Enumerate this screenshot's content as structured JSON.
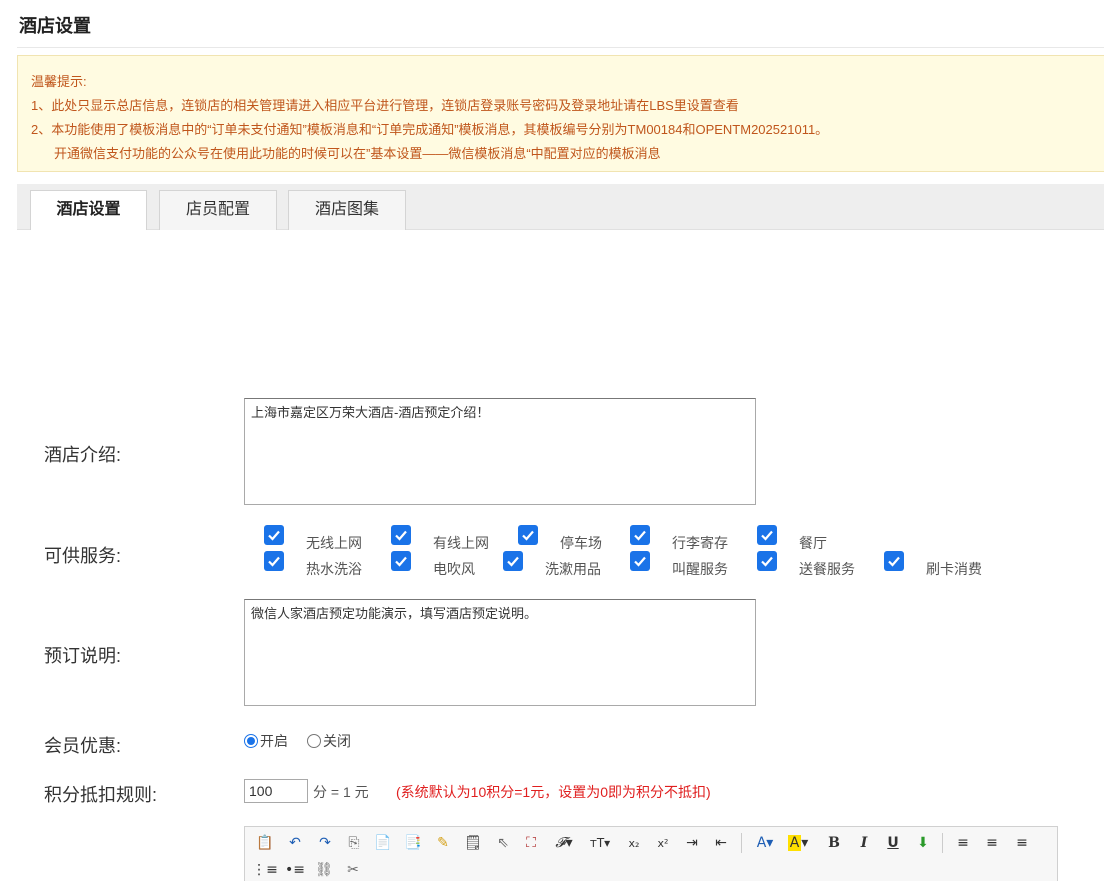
{
  "page": {
    "title": "酒店设置"
  },
  "notice": {
    "heading": "温馨提示:",
    "line1": "1、此处只显示总店信息，连锁店的相关管理请进入相应平台进行管理，连锁店登录账号密码及登录地址请在LBS里设置查看",
    "line2": "2、本功能使用了模板消息中的“订单未支付通知”模板消息和“订单完成通知”模板消息，其模板编号分别为TM00184和OPENTM202521011。",
    "line3": "开通微信支付功能的公众号在使用此功能的时候可以在”基本设置——微信模板消息“中配置对应的模板消息"
  },
  "tabs": [
    {
      "label": "酒店设置",
      "active": true
    },
    {
      "label": "店员配置",
      "active": false
    },
    {
      "label": "酒店图集",
      "active": false
    }
  ],
  "form": {
    "intro": {
      "label": "酒店介绍:",
      "value": "上海市嘉定区万荣大酒店-酒店预定介绍！"
    },
    "services": {
      "label": "可供服务:",
      "items": [
        {
          "label": "无线上网",
          "checked": true
        },
        {
          "label": "有线上网",
          "checked": true
        },
        {
          "label": "停车场",
          "checked": true
        },
        {
          "label": "行李寄存",
          "checked": true
        },
        {
          "label": "餐厅",
          "checked": true
        },
        {
          "label": "热水洗浴",
          "checked": true
        },
        {
          "label": "电吹风",
          "checked": true
        },
        {
          "label": "洗漱用品",
          "checked": true
        },
        {
          "label": "叫醒服务",
          "checked": true
        },
        {
          "label": "送餐服务",
          "checked": true
        },
        {
          "label": "刷卡消费",
          "checked": true
        }
      ]
    },
    "booking": {
      "label": "预订说明:",
      "value": "微信人家酒店预定功能演示，填写酒店预定说明。"
    },
    "member": {
      "label": "会员优惠:",
      "on_label": "开启",
      "off_label": "关闭",
      "selected": "开启"
    },
    "points": {
      "label": "积分抵扣规则:",
      "value": "100",
      "unit": "分 = 1 元",
      "hint": "(系统默认为10积分=1元，设置为0即为积分不抵扣)"
    }
  },
  "colors": {
    "notice_text": "#c0561c",
    "notice_bg": "#fffbe1",
    "accent": "#1a73e8",
    "hint": "#e01f1f"
  },
  "editor_toolbar": [
    "paste-icon",
    "undo-icon",
    "redo-icon",
    "copy-icon",
    "paste-text-icon",
    "paste-word-icon",
    "format-brush-icon",
    "template-icon",
    "select-icon",
    "fullscreen-icon",
    "font-family-icon",
    "font-size-icon",
    "subscript-icon",
    "superscript-icon",
    "indent-icon",
    "outdent-icon",
    "font-color-icon",
    "highlight-icon",
    "bold-icon",
    "italic-icon",
    "underline-icon",
    "strikethrough-icon",
    "align-left-icon",
    "align-center-icon",
    "align-right-icon",
    "ordered-list-icon",
    "unordered-list-icon",
    "link-icon",
    "unlink-icon"
  ]
}
